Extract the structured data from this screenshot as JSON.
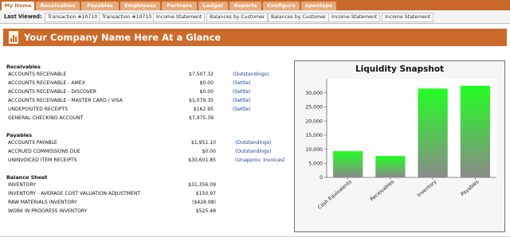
{
  "nav": {
    "tabs": [
      {
        "label": "My Home",
        "active": true
      },
      {
        "label": "Receivables",
        "active": false
      },
      {
        "label": "Payables",
        "active": false
      },
      {
        "label": "Employees",
        "active": false
      },
      {
        "label": "Partners",
        "active": false
      },
      {
        "label": "Ledger",
        "active": false
      },
      {
        "label": "Reports",
        "active": false
      },
      {
        "label": "Configure",
        "active": false
      },
      {
        "label": "opentaps",
        "active": false
      }
    ]
  },
  "last_viewed": {
    "label": "Last Viewed:",
    "items": [
      "Transaction #10710",
      "Transaction #10710",
      "Income Statement",
      "Balances by Customer",
      "Balances by Customer",
      "Income Statement",
      "Income Statement"
    ]
  },
  "page": {
    "title": "Your Company Name Here At a Glance"
  },
  "receivables": {
    "heading": "Receivables",
    "rows": [
      {
        "label": "ACCOUNTS RECEIVABLE",
        "amount": "$7,507.32",
        "link": "(Outstandings)"
      },
      {
        "label": "ACCOUNTS RECEIVABLE - AMEX",
        "amount": "$0.00",
        "link": "(Settle)"
      },
      {
        "label": "ACCOUNTS RECEIVABLE - DISCOVER",
        "amount": "$0.00",
        "link": "(Settle)"
      },
      {
        "label": "ACCOUNTS RECEIVABLE - MASTER CARD / VISA",
        "amount": "$1,079.35",
        "link": "(Settle)"
      },
      {
        "label": "UNDEPOSITED RECEIPTS",
        "amount": "$162.95",
        "link": "(Settle)"
      },
      {
        "label": "GENERAL CHECKING ACCOUNT",
        "amount": "$7,975.39",
        "link": ""
      }
    ]
  },
  "payables": {
    "heading": "Payables",
    "rows": [
      {
        "label": "ACCOUNTS PAYABLE",
        "amount": "$1,951.10",
        "link": "(Outstandings)"
      },
      {
        "label": "ACCRUED COMMISSIONS DUE",
        "amount": "$0.00",
        "link": "(Outstandings)"
      },
      {
        "label": "UNINVOICED ITEM RECEIPTS",
        "amount": "$30,601.85",
        "link": "(Unapprov. Invoices)"
      }
    ]
  },
  "balance_sheet": {
    "heading": "Balance Sheet",
    "rows": [
      {
        "label": "INVENTORY",
        "amount": "$31,356.09"
      },
      {
        "label": "INVENTORY - AVERAGE COST VALUATION ADJUSTMENT",
        "amount": "$150.97"
      },
      {
        "label": "RAW MATERIALS INVENTORY",
        "amount": "($428.98)"
      },
      {
        "label": "WORK IN PROGRESS INVENTORY",
        "amount": "$525.48"
      }
    ]
  },
  "chart_data": {
    "type": "bar",
    "title": "Liquidity Snapshot",
    "categories": [
      "Cash Equivalents",
      "Receivables",
      "Inventory",
      "Payables"
    ],
    "values": [
      9300,
      7600,
      31500,
      32500
    ],
    "ylim": [
      0,
      35000
    ],
    "yticks": [
      "0",
      "5,000",
      "10,000",
      "15,000",
      "20,000",
      "25,000",
      "30,000"
    ],
    "grid": false,
    "colors": {
      "bar_top": "#22ff22",
      "bar_bottom": "#8a8a8a"
    }
  },
  "colors": {
    "brand": "#c9682a",
    "link": "#1a3f9e"
  }
}
